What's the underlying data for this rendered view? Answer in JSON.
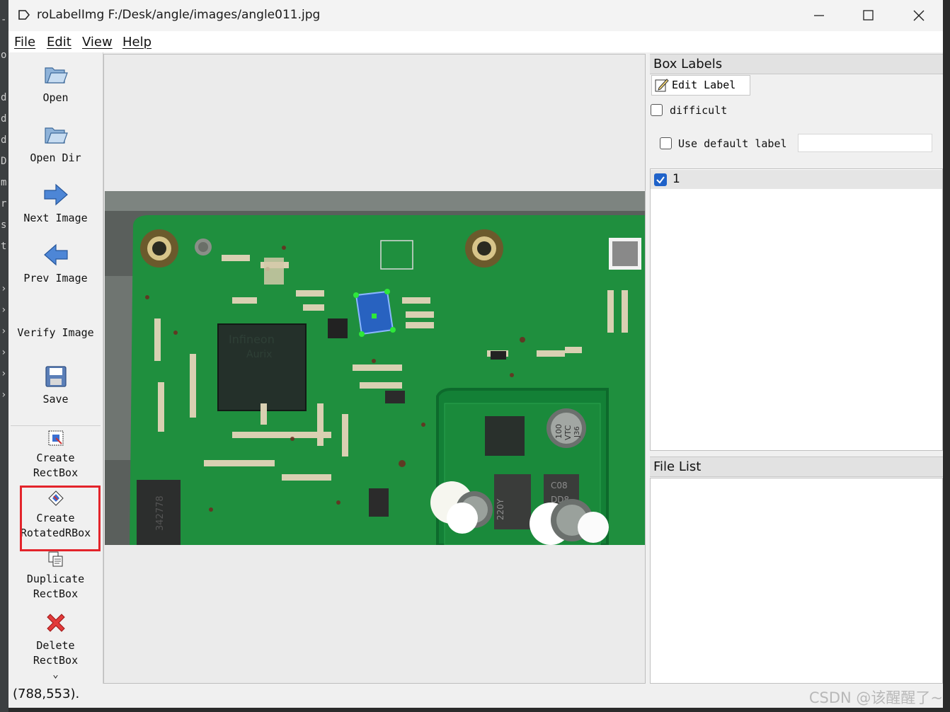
{
  "window": {
    "title": "roLabelImg F:/Desk/angle/images/angle011.jpg"
  },
  "menu": {
    "items": [
      "File",
      "Edit",
      "View",
      "Help"
    ]
  },
  "toolbar": {
    "open": "Open",
    "open_dir": "Open Dir",
    "next_image": "Next Image",
    "prev_image": "Prev Image",
    "verify_image": "Verify Image",
    "save": "Save",
    "create_rectbox_1": "Create",
    "create_rectbox_2": "RectBox",
    "create_rotated_1": "Create",
    "create_rotated_2": "RotatedRBox",
    "duplicate_1": "Duplicate",
    "duplicate_2": "RectBox",
    "delete_1": "Delete",
    "delete_2": "RectBox",
    "more": "⌄"
  },
  "box_labels": {
    "title": "Box Labels",
    "edit_label": "Edit Label",
    "difficult": "difficult",
    "use_default_label": "Use default label",
    "default_label_value": "",
    "labels": [
      {
        "name": "1",
        "checked": true
      }
    ]
  },
  "file_list": {
    "title": "File List",
    "files": []
  },
  "status": {
    "coordinates": "(788,553)."
  },
  "watermark": "CSDN @该醒醒了~",
  "colors": {
    "highlight": "#e3242b",
    "pcb_green": "#1f8f3e",
    "rotated_box": "#2a5bd7"
  },
  "image": {
    "chip_text_1": "Infineon",
    "chip_text_2": "Aurix",
    "cap_text_1": "100",
    "cap_text_2": "VTC",
    "cap_text_3": "J36",
    "inductor_text": "342778",
    "coil_text_1": "220Y",
    "coil_text_2": "C08",
    "coil_text_3": "DD8"
  }
}
